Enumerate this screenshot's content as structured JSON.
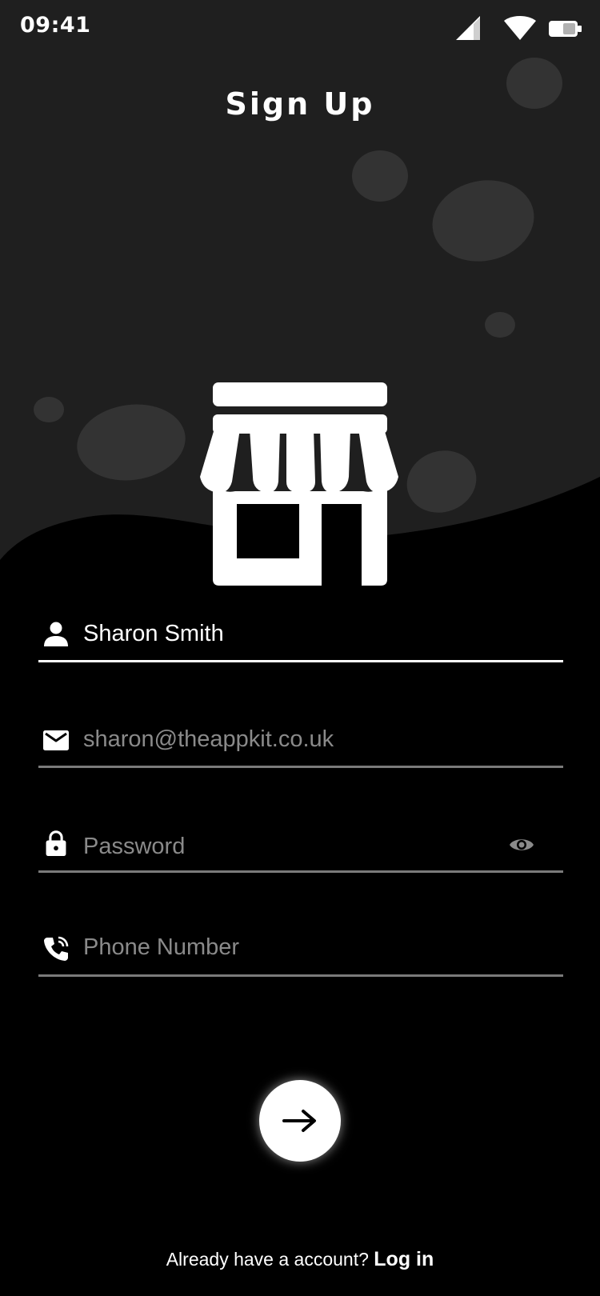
{
  "status_bar": {
    "time": "09:41",
    "icons": [
      "cellular-signal-icon",
      "wifi-icon",
      "battery-icon"
    ]
  },
  "header": {
    "title": "Sign Up"
  },
  "logo": {
    "icon": "storefront-icon"
  },
  "form": {
    "name": {
      "icon": "person-icon",
      "value": "Sharon Smith",
      "placeholder": "",
      "active": true
    },
    "email": {
      "icon": "mail-icon",
      "value": "",
      "placeholder": "sharon@theappkit.co.uk"
    },
    "password": {
      "icon": "lock-icon",
      "value": "",
      "placeholder": "Password",
      "toggle_icon": "eye-icon"
    },
    "phone": {
      "icon": "phone-icon",
      "value": "",
      "placeholder": "Phone Number"
    }
  },
  "submit": {
    "icon": "arrow-right-icon"
  },
  "footer": {
    "prompt": "Already have a account? ",
    "link": "Log in"
  },
  "colors": {
    "background": "#000000",
    "header_background": "#1f1f1f",
    "blob": "#333333",
    "text": "#ffffff",
    "placeholder": "#8a8a8a",
    "underline_inactive": "#7a7a7a",
    "underline_active": "#ffffff"
  }
}
